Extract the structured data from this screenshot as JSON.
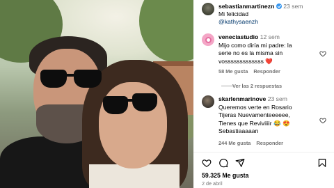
{
  "post": {
    "author": "sebastianmartinezn",
    "verified": true,
    "time_ago": "23 sem",
    "caption_line1": "Mi felicidad",
    "caption_mention": "@kathysaenzh"
  },
  "comments": [
    {
      "username": "veneciastudio",
      "time_ago": "12 sem",
      "text_lines": [
        "Mijo como diría mi padre: la",
        "serie no es la misma sin",
        "vosssssssssssss ❤️"
      ],
      "likes_label": "58 Me gusta",
      "reply_label": "Responder",
      "replies_label": "Ver las 2 respuestas"
    },
    {
      "username": "skarlenmarinove",
      "time_ago": "23 sem",
      "text_lines": [
        "Queremos verte en Rosario",
        "Tijeras Nuevamenteeeeee,",
        "Tienes que Reviviiiir 😂 😍",
        "Sebastiaaaaan"
      ],
      "likes_label": "244 Me gusta",
      "reply_label": "Responder"
    }
  ],
  "footer": {
    "likes_count": "59.325 Me gusta",
    "date": "2 de abril"
  },
  "icons": {
    "like": "heart-icon",
    "comment": "comment-icon",
    "share": "share-icon",
    "save": "bookmark-icon",
    "more": "more-options-icon"
  },
  "colors": {
    "link": "#00376b",
    "meta": "#737373",
    "verified": "#3897f0"
  }
}
